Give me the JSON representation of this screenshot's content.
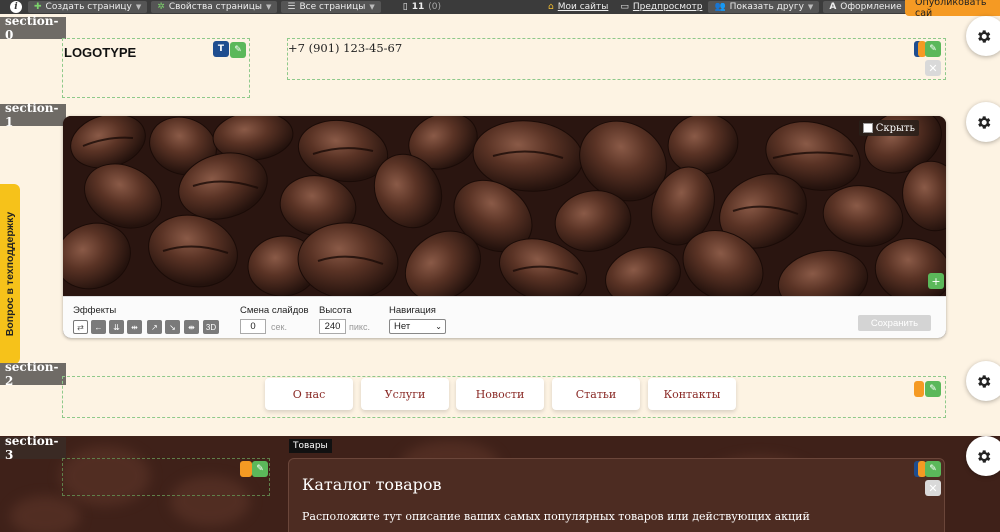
{
  "toolbar": {
    "create_page": "Создать страницу",
    "page_props": "Свойства страницы",
    "all_pages": "Все страницы",
    "pages_count": "11",
    "pages_sub": "(0)",
    "my_sites": "Мои сайты",
    "preview": "Предпросмотр",
    "show_friend": "Показать другу",
    "design": "Оформление",
    "publish": "Опубликовать сай"
  },
  "sections": [
    "section-0",
    "section-1",
    "section-2",
    "section-3"
  ],
  "header": {
    "logo": "LOGOTYPE",
    "logo_badge": "T",
    "phone": "+7 (901) 123-45-67"
  },
  "slider": {
    "hide_label": "Скрыть",
    "effects_label": "Эффекты",
    "effects_3d": "3D",
    "slide_change_label": "Смена слайдов",
    "slide_change_value": "0",
    "slide_change_unit": "сек.",
    "height_label": "Высота",
    "height_value": "240",
    "height_unit": "пикс.",
    "navigation_label": "Навигация",
    "navigation_value": "Нет",
    "save_label": "Сохранить"
  },
  "support_label": "Вопрос в техподдержку",
  "nav": {
    "items": [
      "О нас",
      "Услуги",
      "Новости",
      "Статьи",
      "Контакты"
    ]
  },
  "catalog": {
    "tag": "Товары",
    "title": "Каталог товаров",
    "description": "Расположите тут описание ваших самых популярных товаров или действующих акций"
  },
  "colors": {
    "page_bg": "#fdf3e3",
    "edit_green": "#5bb85a",
    "accent_orange": "#f59a23",
    "nav_text": "#8a2a26",
    "dark_section": "#3f2119"
  }
}
